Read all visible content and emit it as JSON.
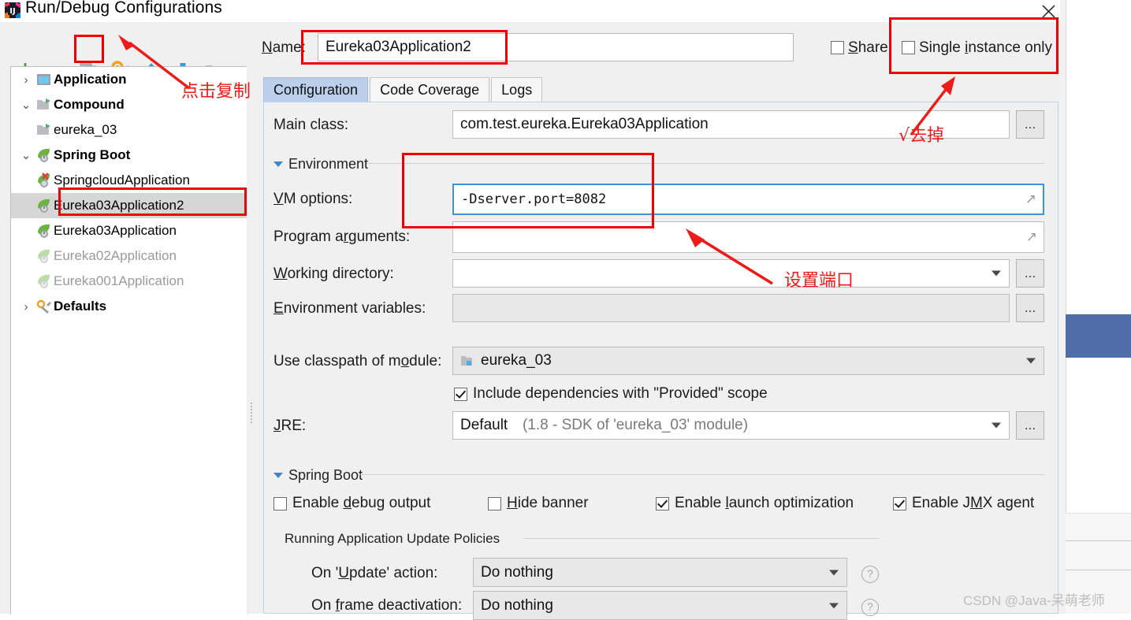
{
  "window": {
    "title": "Run/Debug Configurations",
    "app_icon": "intellij-idea-icon",
    "close_label": "✕"
  },
  "toolbar": {
    "items": [
      {
        "name": "add-configuration-button",
        "icon": "plus-icon",
        "label": "+"
      },
      {
        "name": "remove-configuration-button",
        "icon": "minus-icon",
        "label": "−"
      },
      {
        "name": "copy-configuration-button",
        "icon": "copy-icon",
        "label": "Copy Configuration"
      },
      {
        "name": "edit-templates-button",
        "icon": "gear-wrench-icon",
        "label": "Edit Templates"
      },
      {
        "name": "move-up-button",
        "icon": "arrow-up-icon",
        "label": "Move Up"
      },
      {
        "name": "move-down-button",
        "icon": "arrow-down-icon",
        "label": "Move Down"
      },
      {
        "name": "folder-button",
        "icon": "folder-icon",
        "label": "Create Folder"
      },
      {
        "name": "more-button",
        "icon": "chevron-double-right-icon",
        "label": "»"
      }
    ],
    "more_label": "»"
  },
  "tree": {
    "items": [
      {
        "label": "Application",
        "icon": "application-icon",
        "twisty": "›",
        "depth": 0,
        "bold": true,
        "dim": false,
        "selected": false
      },
      {
        "label": "Compound",
        "icon": "compound-icon",
        "twisty": "⌄",
        "depth": 0,
        "bold": true,
        "dim": false,
        "selected": false
      },
      {
        "label": "eureka_03",
        "icon": "compound-icon",
        "twisty": "",
        "depth": 1,
        "bold": false,
        "dim": false,
        "selected": false
      },
      {
        "label": "Spring Boot",
        "icon": "spring-boot-icon",
        "twisty": "⌄",
        "depth": 0,
        "bold": true,
        "dim": false,
        "selected": false
      },
      {
        "label": "SpringcloudApplication",
        "icon": "spring-boot-error-icon",
        "twisty": "",
        "depth": 1,
        "bold": false,
        "dim": false,
        "selected": false
      },
      {
        "label": "Eureka03Application2",
        "icon": "spring-boot-icon",
        "twisty": "",
        "depth": 1,
        "bold": false,
        "dim": false,
        "selected": true
      },
      {
        "label": "Eureka03Application",
        "icon": "spring-boot-icon",
        "twisty": "",
        "depth": 1,
        "bold": false,
        "dim": false,
        "selected": false
      },
      {
        "label": "Eureka02Application",
        "icon": "spring-boot-icon",
        "twisty": "",
        "depth": 1,
        "bold": false,
        "dim": true,
        "selected": false
      },
      {
        "label": "Eureka001Application",
        "icon": "spring-boot-icon",
        "twisty": "",
        "depth": 1,
        "bold": false,
        "dim": true,
        "selected": false
      },
      {
        "label": "Defaults",
        "icon": "defaults-icon",
        "twisty": "›",
        "depth": 0,
        "bold": true,
        "dim": false,
        "selected": false
      }
    ]
  },
  "header": {
    "name_label": "Name:",
    "name_label_mnemonic": "N",
    "name_value": "Eureka03Application2",
    "share_label": "Share",
    "share_mnemonic": "S",
    "share_checked": false,
    "single_instance_label": "Single instance only",
    "single_instance_mnemonic": "i",
    "single_instance_checked": false
  },
  "tabs": [
    {
      "label": "Configuration",
      "active": true
    },
    {
      "label": "Code Coverage",
      "active": false
    },
    {
      "label": "Logs",
      "active": false
    }
  ],
  "configuration": {
    "main_class": {
      "label": "Main class:",
      "value": "com.test.eureka.Eureka03Application",
      "browse_label": "..."
    },
    "environment_section": "Environment",
    "vm_options": {
      "label": "VM options:",
      "mnemonic": "V",
      "value": "-Dserver.port=8082",
      "expand_icon": "expand-diagonal-icon"
    },
    "program_arguments": {
      "label": "Program arguments:",
      "mnemonic": "r",
      "value": "",
      "expand_icon": "expand-diagonal-icon"
    },
    "working_directory": {
      "label": "Working directory:",
      "mnemonic": "W",
      "value": "",
      "browse_label": "..."
    },
    "environment_variables": {
      "label": "Environment variables:",
      "mnemonic": "E",
      "value": "",
      "browse_label": "..."
    },
    "use_classpath": {
      "label": "Use classpath of module:",
      "mnemonic": "o",
      "value": "eureka_03",
      "icon": "module-icon"
    },
    "include_provided": {
      "label": "Include dependencies with \"Provided\" scope",
      "checked": true
    },
    "jre": {
      "label": "JRE:",
      "mnemonic": "J",
      "value": "Default",
      "hint": "(1.8 - SDK of 'eureka_03' module)",
      "browse_label": "..."
    }
  },
  "spring_boot": {
    "section_title": "Spring Boot",
    "checkboxes": [
      {
        "label": "Enable debug output",
        "mnemonic": "d",
        "checked": false
      },
      {
        "label": "Hide banner",
        "mnemonic": "H",
        "checked": false
      },
      {
        "label": "Enable launch optimization",
        "mnemonic": "l",
        "checked": true
      },
      {
        "label": "Enable JMX agent",
        "mnemonic": "M",
        "checked": true
      }
    ],
    "policies_group": "Running Application Update Policies",
    "on_update": {
      "label": "On 'Update' action:",
      "mnemonic": "U",
      "value": "Do nothing",
      "help": "?"
    },
    "on_frame_deactivation": {
      "label": "On frame deactivation:",
      "mnemonic": "f",
      "value": "Do nothing",
      "help": "?"
    }
  },
  "annotations": [
    {
      "name": "annotation-click-copy",
      "text": "点击复制"
    },
    {
      "name": "annotation-uncheck",
      "text": "√去掉"
    },
    {
      "name": "annotation-set-port",
      "text": "设置端口"
    }
  ],
  "watermark": "CSDN @Java-呆萌老师",
  "colors": {
    "annotation_red": "#ee1b1b",
    "highlight_box": "#ef0000",
    "tab_active": "#bcd0ec",
    "tree_selected": "#d6d6d6",
    "focus_border": "#3c94e0",
    "bg_selection_blue": "#4f6da8",
    "toolbar_add_green": "#4aa84a",
    "toolbar_remove_red": "#d05050",
    "toolbar_arrow_blue": "#2e9fd8"
  }
}
